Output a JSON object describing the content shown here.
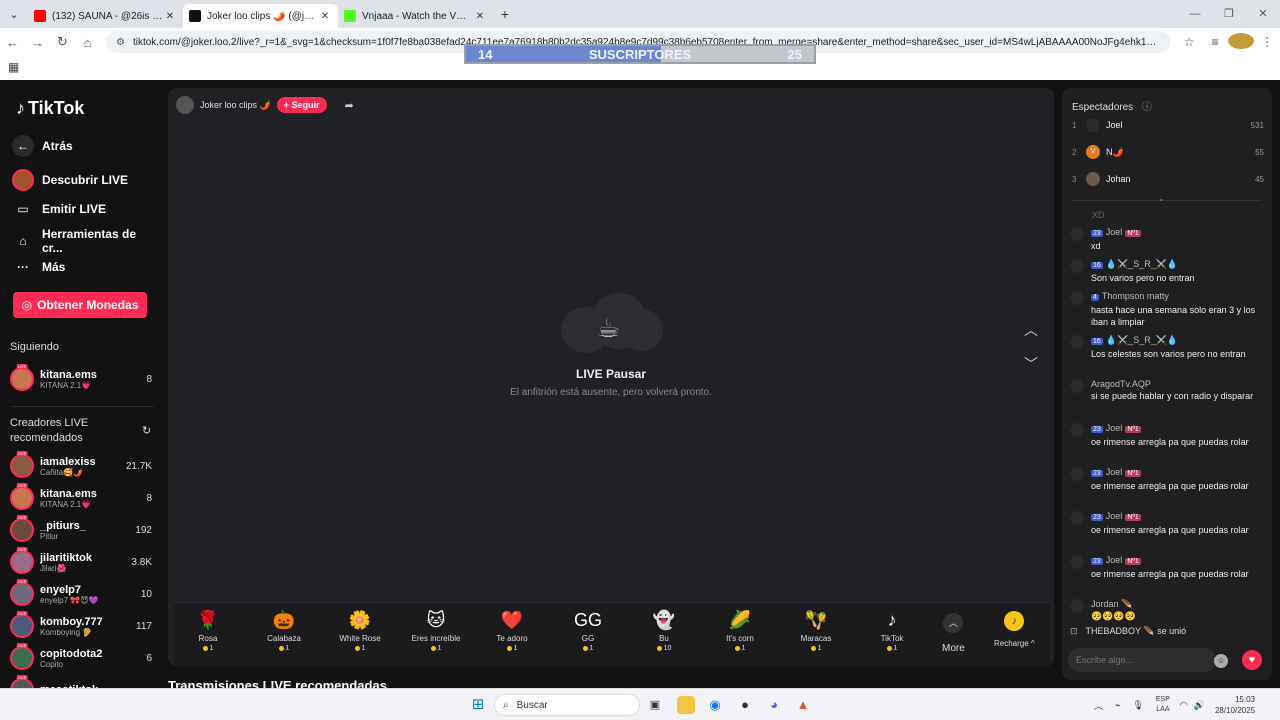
{
  "browser": {
    "tabs": [
      {
        "title": "(132) SAUNA - @26is - YouTube",
        "color": "#ff0000",
        "active": false
      },
      {
        "title": "Joker loo clips 🌶️ (@joker.loo.2",
        "color": "#111111",
        "active": true
      },
      {
        "title": "Vnjaaa - Watch the VOD on Kick",
        "color": "#53fc18",
        "active": false
      }
    ],
    "new_tab": "+",
    "url": "tiktok.com/@joker.loo.2/live?_r=1&_svg=1&checksum=1f0f7fe8ba038efad24c711ee7a76918b80b2dc35a924b8e9c7d99c38b6eb5708enter_from_merge=share&enter_method=share&sec_user_id=MS4wLjABAAAA00NoJFg4ehk1Wa4ShZ2n_Acuqv_tVxR..."
  },
  "overlay": {
    "left": "14",
    "label": "SUSCRIPTORES",
    "right": "25",
    "progress": 0.56
  },
  "sidebar": {
    "logo": "TikTok",
    "back": "Atrás",
    "nav": [
      {
        "label": "Descubrir LIVE",
        "icon": "live-avatar-icon"
      },
      {
        "label": "Emitir LIVE",
        "icon": "camera-icon"
      },
      {
        "label": "Herramientas de cr...",
        "icon": "lightbulb-icon"
      },
      {
        "label": "Más",
        "icon": "more-dots-icon"
      }
    ],
    "coins_button": "Obtener Monedas",
    "following_heading": "Siguiendo",
    "following": [
      {
        "name": "kitana.ems",
        "sub": "KITANA 2.1💗",
        "count": "8",
        "color": "#c8764f"
      }
    ],
    "recommended_heading": "Creadores LIVE recomendados",
    "recommended": [
      {
        "name": "iamalexiss",
        "sub": "Cañita🥰🌶️",
        "count": "21.7K",
        "color": "#8c5a46"
      },
      {
        "name": "kitana.ems",
        "sub": "KITANA 2.1💗",
        "count": "8",
        "color": "#c8764f"
      },
      {
        "name": "_pitiurs_",
        "sub": "Pitiur",
        "count": "192",
        "color": "#6b4a3a"
      },
      {
        "name": "jilaritiktok",
        "sub": "Jilari🌺",
        "count": "3.8K",
        "color": "#9a6b8a"
      },
      {
        "name": "enyelp7",
        "sub": "enyelp7 🎀😈💜",
        "count": "10",
        "color": "#6f6a7d"
      },
      {
        "name": "komboy.777",
        "sub": "Komboying 🦻",
        "count": "117",
        "color": "#4b5a7a"
      },
      {
        "name": "copitodota2",
        "sub": "Copito",
        "count": "6",
        "color": "#3f6b4d"
      },
      {
        "name": "mesotiktok",
        "sub": "",
        "count": "",
        "color": "#555555"
      }
    ]
  },
  "stage": {
    "host_name": "Joker loo clips 🌶️",
    "follow": "+ Seguir",
    "pause_title": "LIVE Pausar",
    "pause_sub": "El anfitrión está ausente, pero volverá pronto."
  },
  "gifts": [
    {
      "name": "Rosa",
      "price": "1",
      "icon": "🌹"
    },
    {
      "name": "Calabaza",
      "price": "1",
      "icon": "🎃"
    },
    {
      "name": "White Rose",
      "price": "1",
      "icon": "🌼"
    },
    {
      "name": "Eres increíble",
      "price": "1",
      "icon": "🐱"
    },
    {
      "name": "Te adoro",
      "price": "1",
      "icon": "❤️"
    },
    {
      "name": "GG",
      "price": "1",
      "icon": "GG"
    },
    {
      "name": "Bu",
      "price": "10",
      "icon": "👻"
    },
    {
      "name": "It's corn",
      "price": "1",
      "icon": "🌽"
    },
    {
      "name": "Maracas",
      "price": "1",
      "icon": "🪇"
    },
    {
      "name": "TikTok",
      "price": "1",
      "icon": "♪"
    }
  ],
  "gift_more": "More",
  "recharge": "Recharge ^",
  "section_title": "Transmisiones LIVE recomendadas",
  "chat": {
    "viewers_title": "Espectadores",
    "viewers": [
      {
        "rank": "1",
        "name": "Joel",
        "count": "531",
        "color": "#2a2a2a",
        "initial": ""
      },
      {
        "rank": "2",
        "name": "N🌶️",
        "count": "55",
        "color": "#e57c1f",
        "initial": "V"
      },
      {
        "rank": "3",
        "name": "Johan",
        "count": "45",
        "color": "#6a5a4a",
        "initial": ""
      }
    ],
    "cut_text": "XD",
    "messages": [
      {
        "lvl": "23",
        "user": "Joel",
        "rank": "Nº1",
        "text": "xd"
      },
      {
        "lvl": "16",
        "user": "💧⚔️_S_R_⚔️💧",
        "rank": "",
        "text": "Son varios pero no entran"
      },
      {
        "lvl": "4",
        "user": "Thompson matty",
        "rank": "",
        "text": "hasta hace una semana solo eran 3 y los iban a limpiar"
      },
      {
        "lvl": "16",
        "user": "💧⚔️_S_R_⚔️💧",
        "rank": "",
        "text": "Los celestes son varios pero no entran"
      },
      {
        "lvl": "",
        "user": "AragodTv.AQP",
        "rank": "",
        "text": "si se puede hablar y con radio y disparar"
      },
      {
        "lvl": "23",
        "user": "Joel",
        "rank": "Nº1",
        "text": "oe rimense arregla pa que puedas rolar"
      },
      {
        "lvl": "23",
        "user": "Joel",
        "rank": "Nº1",
        "text": "oe rimense arregla pa que puedas rolar"
      },
      {
        "lvl": "23",
        "user": "Joel",
        "rank": "Nº1",
        "text": "oe rimense arregla pa que puedas rolar"
      },
      {
        "lvl": "23",
        "user": "Joel",
        "rank": "Nº1",
        "text": "oe rimense arregla pa que puedas rolar"
      },
      {
        "lvl": "",
        "user": "Jordan 🪶",
        "rank": "",
        "text": "🥺🥺🥺🥺"
      }
    ],
    "joined": "THEBADBOY 🪶  se unió",
    "input_placeholder": "Escribe algo..."
  },
  "taskbar": {
    "search": "Buscar",
    "lang_top": "ESP",
    "lang_bottom": "LAA",
    "time": "15:03",
    "date": "28/10/2025"
  }
}
